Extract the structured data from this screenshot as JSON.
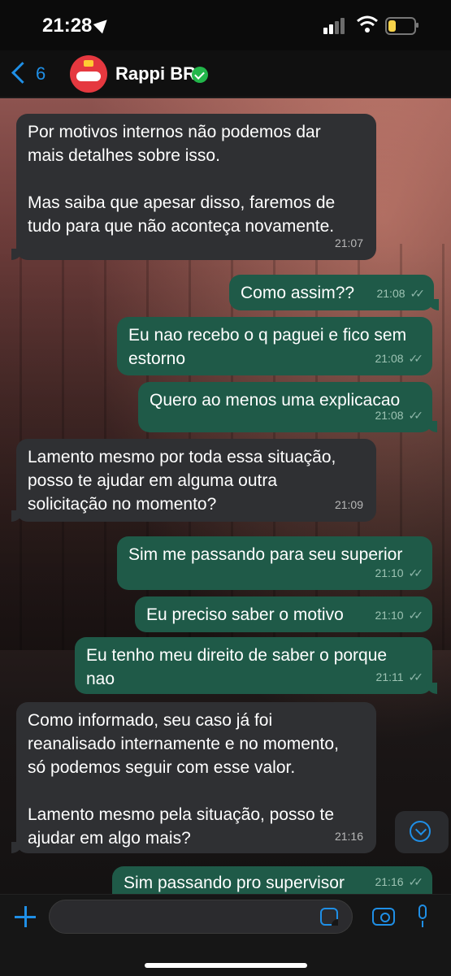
{
  "status_bar": {
    "time": "21:28",
    "icons": [
      "location-arrow-icon",
      "cellular-signal-icon",
      "wifi-icon",
      "battery-icon"
    ]
  },
  "header": {
    "back_count": "6",
    "contact_name": "Rappi BR",
    "verified": true
  },
  "messages": [
    {
      "dir": "in",
      "text": "Por motivos internos não podemos dar\nmais detalhes sobre isso.\n\nMas saiba que apesar disso, faremos de\ntudo para que não aconteça novamente.",
      "time": "21:07"
    },
    {
      "dir": "out",
      "text": "Como assim??",
      "time": "21:08"
    },
    {
      "dir": "out",
      "text": "Eu nao recebo o q paguei e fico sem\nestorno",
      "time": "21:08"
    },
    {
      "dir": "out",
      "text": "Quero ao menos uma explicacao",
      "time": "21:08"
    },
    {
      "dir": "in",
      "text": "Lamento mesmo por toda essa situação,\nposso te ajudar em alguma outra\nsolicitação no momento?",
      "time": "21:09"
    },
    {
      "dir": "out",
      "text": "Sim me passando para seu superior",
      "time": "21:10"
    },
    {
      "dir": "out",
      "text": "Eu preciso saber o motivo",
      "time": "21:10"
    },
    {
      "dir": "out",
      "text": "Eu tenho meu direito de saber o porque\nnao",
      "time": "21:11"
    },
    {
      "dir": "in",
      "text": "Como informado, seu caso já foi\nreanalisado internamente e no momento,\nsó podemos seguir com esse valor.\n\nLamento mesmo pela situação, posso te\najudar em algo mais?",
      "time": "21:16"
    },
    {
      "dir": "out",
      "text": "Sim passando pro supervisor",
      "time": "21:16"
    }
  ],
  "composer": {
    "placeholder": "",
    "icons": [
      "plus-icon",
      "sticker-icon",
      "camera-icon",
      "microphone-icon"
    ]
  },
  "colors": {
    "accent": "#1f8fe6",
    "incoming_bubble": "#2f3033",
    "outgoing_bubble": "#1f5a48",
    "verified": "#22b64a"
  }
}
